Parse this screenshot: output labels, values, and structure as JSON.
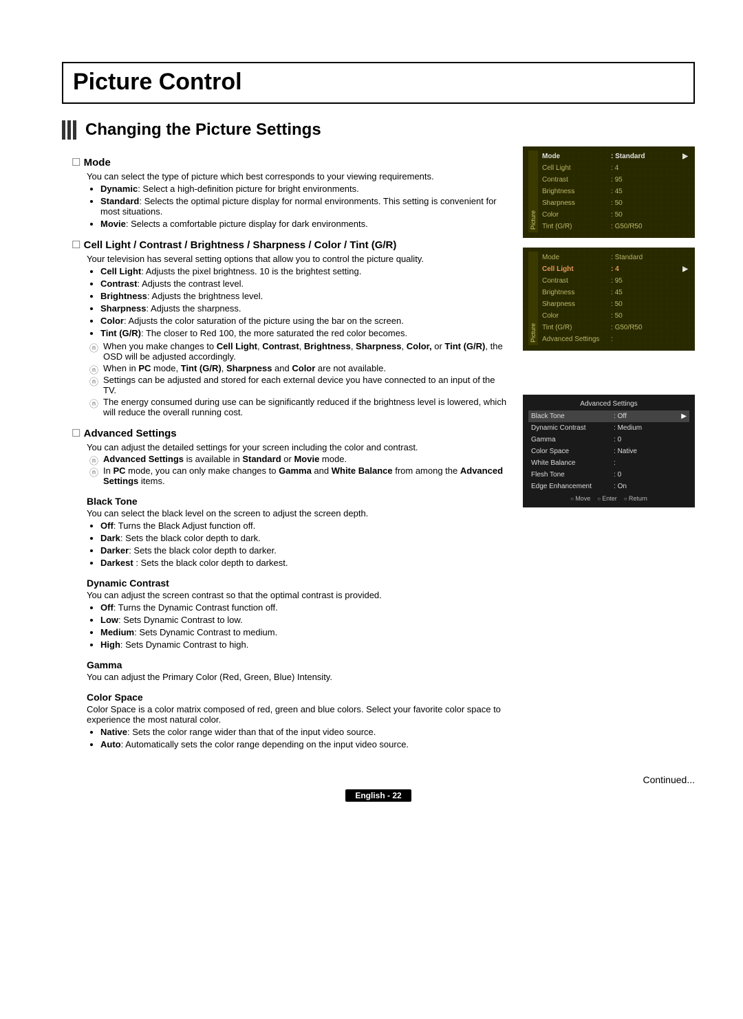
{
  "page": {
    "title": "Picture Control",
    "subtitle": "Changing the Picture Settings",
    "continued": "Continued...",
    "footer": "English - 22"
  },
  "mode": {
    "head": "Mode",
    "intro": "You can select the type of picture which best corresponds to your viewing requirements.",
    "items": [
      {
        "b": "Dynamic",
        "t": ": Select a high-definition picture for bright environments."
      },
      {
        "b": "Standard",
        "t": ": Selects the optimal picture display for normal environments. This setting is convenient for most situations."
      },
      {
        "b": "Movie",
        "t": ": Selects a comfortable picture display for dark environments."
      }
    ]
  },
  "quality": {
    "head": "Cell Light / Contrast / Brightness / Sharpness / Color / Tint (G/R)",
    "intro": "Your television has several setting options that allow you to control the picture quality.",
    "items": [
      {
        "b": "Cell Light",
        "t": ": Adjusts the pixel brightness. 10 is the brightest setting."
      },
      {
        "b": "Contrast",
        "t": ": Adjusts the contrast level."
      },
      {
        "b": "Brightness",
        "t": ": Adjusts the brightness level."
      },
      {
        "b": "Sharpness",
        "t": ": Adjusts the sharpness."
      },
      {
        "b": "Color",
        "t": ": Adjusts the color saturation of the picture using the bar on the screen."
      },
      {
        "b": "Tint (G/R)",
        "t": ": The closer to Red 100, the more saturated the red color becomes."
      }
    ],
    "notes": {
      "n1a": "When you make changes to ",
      "n1b": "Cell Light",
      "n1c": ", ",
      "n1d": "Contrast",
      "n1e": ", ",
      "n1f": "Brightness",
      "n1g": ", ",
      "n1h": "Sharpness",
      "n1i": ", ",
      "n1j": "Color,",
      "n1k": " or ",
      "n1l": "Tint (G/R)",
      "n1m": ", the OSD will be adjusted accordingly.",
      "n2a": "When in ",
      "n2b": "PC",
      "n2c": " mode, ",
      "n2d": "Tint (G/R)",
      "n2e": ", ",
      "n2f": "Sharpness",
      "n2g": " and ",
      "n2h": "Color",
      "n2i": " are not available.",
      "n3": "Settings can be adjusted and stored for each external device you have connected to an input of the TV.",
      "n4": "The energy consumed during use can be significantly reduced if the brightness level is lowered, which will reduce the overall running cost."
    }
  },
  "advanced": {
    "head": "Advanced Settings",
    "intro": "You can adjust the detailed settings for your screen including the color and contrast.",
    "n1a": "Advanced Settings",
    "n1b": " is available in ",
    "n1c": "Standard",
    "n1d": " or ",
    "n1e": "Movie",
    "n1f": " mode.",
    "n2a": "In ",
    "n2b": "PC",
    "n2c": " mode, you can only make changes to ",
    "n2d": "Gamma",
    "n2e": " and ",
    "n2f": "White Balance",
    "n2g": " from among the ",
    "n2h": "Advanced Settings",
    "n2i": " items.",
    "blacktone": {
      "head": "Black Tone",
      "desc": "You can select the black level on the screen to adjust the screen depth.",
      "items": [
        {
          "b": "Off",
          "t": ": Turns the Black Adjust function off."
        },
        {
          "b": "Dark",
          "t": ": Sets the black color depth to dark."
        },
        {
          "b": "Darker",
          "t": ": Sets the black color depth to darker."
        },
        {
          "b": "Darkest ",
          "t": ": Sets the black color depth to darkest."
        }
      ]
    },
    "dyncontrast": {
      "head": "Dynamic Contrast",
      "desc": "You can adjust the screen contrast so that the optimal contrast is provided.",
      "items": [
        {
          "b": "Off",
          "t": ": Turns the Dynamic Contrast function off."
        },
        {
          "b": "Low",
          "t": ": Sets Dynamic Contrast to low."
        },
        {
          "b": "Medium",
          "t": ": Sets Dynamic Contrast to medium."
        },
        {
          "b": "High",
          "t": ": Sets Dynamic Contrast to high."
        }
      ]
    },
    "gamma": {
      "head": "Gamma",
      "desc": "You can adjust the Primary Color (Red, Green, Blue) Intensity."
    },
    "colorspace": {
      "head": "Color Space",
      "desc": "Color Space is a color matrix composed of red, green and blue colors. Select your favorite color space to experience the most natural color.",
      "items": [
        {
          "b": "Native",
          "t": ": Sets the color range wider than that of the input video source."
        },
        {
          "b": "Auto",
          "t": ": Automatically sets the color range depending on the input video source."
        }
      ]
    }
  },
  "osd1": {
    "sideLabel": "Picture",
    "rows": [
      {
        "k": "Mode",
        "v": "Standard",
        "hl": true,
        "arrow": true
      },
      {
        "k": "Cell Light",
        "v": "4"
      },
      {
        "k": "Contrast",
        "v": "95"
      },
      {
        "k": "Brightness",
        "v": "45"
      },
      {
        "k": "Sharpness",
        "v": "50"
      },
      {
        "k": "Color",
        "v": "50"
      },
      {
        "k": "Tint (G/R)",
        "v": "G50/R50"
      }
    ]
  },
  "osd2": {
    "sideLabel": "Picture",
    "rows": [
      {
        "k": "Mode",
        "v": "Standard"
      },
      {
        "k": "Cell Light",
        "v": "4",
        "hl2": true,
        "arrow": true
      },
      {
        "k": "Contrast",
        "v": "95"
      },
      {
        "k": "Brightness",
        "v": "45"
      },
      {
        "k": "Sharpness",
        "v": "50"
      },
      {
        "k": "Color",
        "v": "50"
      },
      {
        "k": "Tint (G/R)",
        "v": "G50/R50"
      },
      {
        "k": "Advanced Settings",
        "v": ""
      }
    ]
  },
  "osd3": {
    "title": "Advanced Settings",
    "rows": [
      {
        "k": "Black Tone",
        "v": "Off",
        "sel": true,
        "arrow": true
      },
      {
        "k": "Dynamic Contrast",
        "v": "Medium"
      },
      {
        "k": "Gamma",
        "v": "0"
      },
      {
        "k": "Color Space",
        "v": "Native"
      },
      {
        "k": "White Balance",
        "v": ""
      },
      {
        "k": "Flesh Tone",
        "v": "0"
      },
      {
        "k": "Edge Enhancement",
        "v": "On"
      }
    ],
    "footer": [
      "Move",
      "Enter",
      "Return"
    ]
  }
}
